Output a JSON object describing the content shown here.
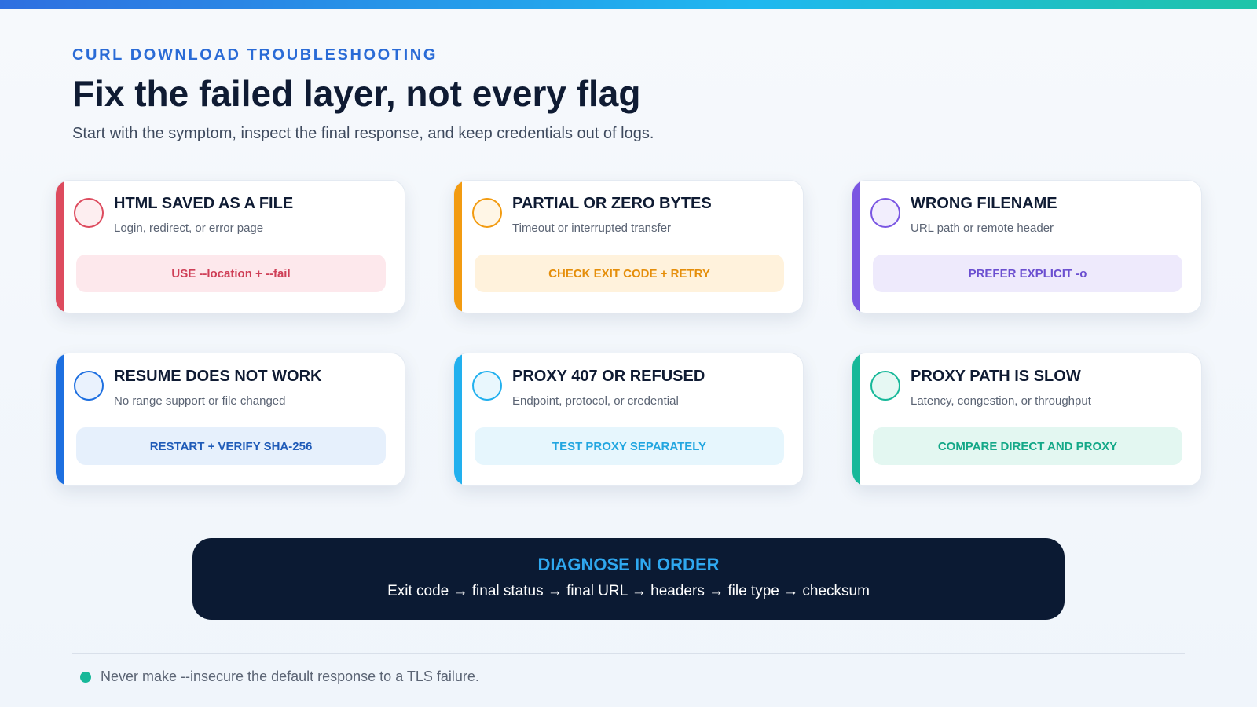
{
  "header": {
    "eyebrow": "CURL DOWNLOAD TROUBLESHOOTING",
    "title": "Fix the failed layer, not every flag",
    "subtitle": "Start with the symptom, inspect the final response, and keep credentials out of logs."
  },
  "cards": [
    {
      "title": "HTML SAVED AS A FILE",
      "subtitle": "Login, redirect, or error page",
      "action": "USE --location + --fail",
      "accent": "#dd4b5e",
      "circle_bg": "#fdeef0",
      "action_bg": "#fde8ec",
      "action_color": "#cf3f57"
    },
    {
      "title": "PARTIAL OR ZERO BYTES",
      "subtitle": "Timeout or interrupted transfer",
      "action": "CHECK EXIT CODE + RETRY",
      "accent": "#f29b11",
      "circle_bg": "#fff6e6",
      "action_bg": "#fff2dc",
      "action_color": "#e58e0a"
    },
    {
      "title": "WRONG FILENAME",
      "subtitle": "URL path or remote header",
      "action": "PREFER EXPLICIT -o",
      "accent": "#7a56e2",
      "circle_bg": "#f2eefd",
      "action_bg": "#eeeafc",
      "action_color": "#6b4fd0"
    },
    {
      "title": "RESUME DOES NOT WORK",
      "subtitle": "No range support or file changed",
      "action": "RESTART + VERIFY SHA-256",
      "accent": "#1d6fe0",
      "circle_bg": "#eaf2fd",
      "action_bg": "#e6f0fc",
      "action_color": "#1f5bb8"
    },
    {
      "title": "PROXY 407 OR REFUSED",
      "subtitle": "Endpoint, protocol, or credential",
      "action": "TEST PROXY SEPARATELY",
      "accent": "#22b0ee",
      "circle_bg": "#e9f7fd",
      "action_bg": "#e6f6fd",
      "action_color": "#22a6e0"
    },
    {
      "title": "PROXY PATH IS SLOW",
      "subtitle": "Latency, congestion, or throughput",
      "action": "COMPARE DIRECT AND PROXY",
      "accent": "#17b899",
      "circle_bg": "#e6f8f3",
      "action_bg": "#e3f7f1",
      "action_color": "#14a888"
    }
  ],
  "diagnose": {
    "title": "DIAGNOSE IN ORDER",
    "steps": "Exit code → final status → final URL → headers → file type → checksum"
  },
  "note": {
    "text": "Never make --insecure the default response to a TLS failure.",
    "dot_color": "#17b899"
  }
}
